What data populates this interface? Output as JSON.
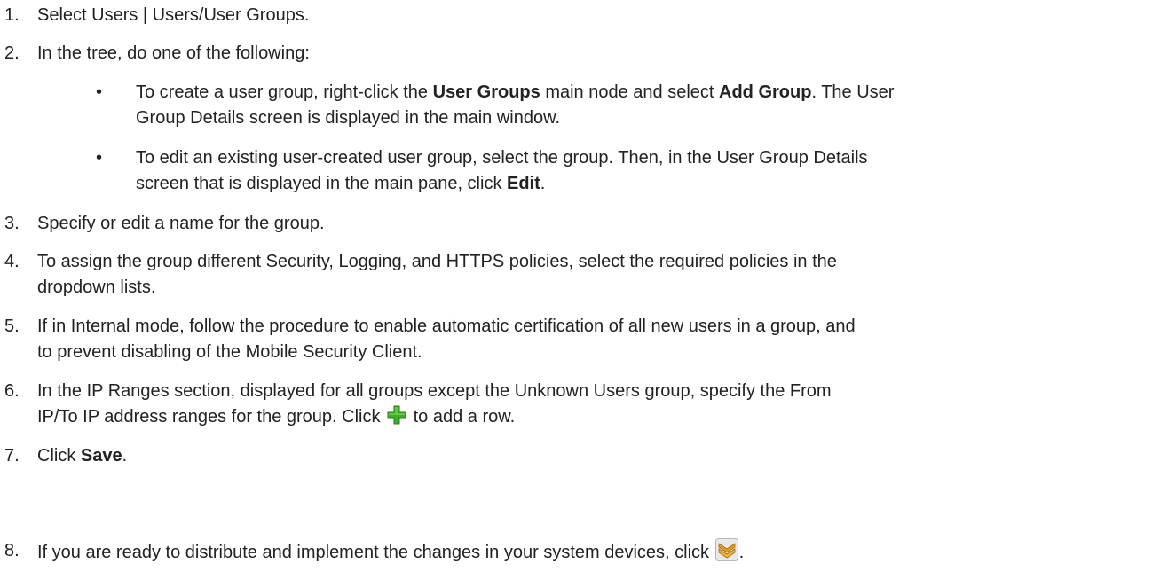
{
  "steps": [
    {
      "num": "1.",
      "text": "Select Users | Users/User Groups."
    },
    {
      "num": "2.",
      "text": "In the tree, do one of the following:"
    },
    {
      "num": "3.",
      "text": "Specify or edit a name for the group."
    },
    {
      "num": "4.",
      "text_line1": "To assign the group different Security, Logging, and HTTPS policies, select the required policies in the",
      "text_line2": "dropdown lists."
    },
    {
      "num": "5.",
      "text_line1": "If in Internal mode, follow the procedure to enable automatic certification of all new users in a group, and",
      "text_line2": "to prevent disabling of the Mobile Security Client."
    },
    {
      "num": "6.",
      "text_line1": "In the IP Ranges section, displayed for all groups except the Unknown Users group, specify the From",
      "text_line2_a": "IP/To IP address ranges for the group. Click ",
      "text_line2_b": " to add a row."
    },
    {
      "num": "7.",
      "text_a": "Click ",
      "bold": "Save",
      "text_b": "."
    },
    {
      "num": "8.",
      "text_a": "If you are ready to distribute and implement the changes in your system devices, click ",
      "text_b": "."
    }
  ],
  "bullets": [
    {
      "dot": "•",
      "a": "To create a user group, right-click the ",
      "b1": "User Groups",
      "c": " main node and select ",
      "b2": "Add Group",
      "d": ". The User",
      "line2": "Group Details screen is displayed in the main window."
    },
    {
      "dot": "•",
      "line1": "To edit an existing user-created user group, select the group. Then, in the User Group Details",
      "a": "screen that is displayed in the main pane, click ",
      "b1": "Edit",
      "d": "."
    }
  ],
  "icons": {
    "add_row": "plus-icon",
    "deploy": "deploy-chevrons-icon",
    "plus_color": "#3fae2a",
    "deploy_color": "#e0a020"
  }
}
